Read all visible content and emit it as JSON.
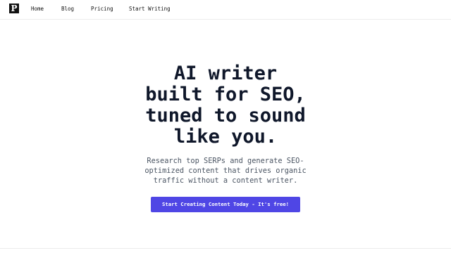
{
  "brand": {
    "logo_text": "P"
  },
  "nav": {
    "items": [
      {
        "label": "Home"
      },
      {
        "label": "Blog"
      },
      {
        "label": "Pricing"
      },
      {
        "label": "Start Writing"
      }
    ]
  },
  "hero": {
    "headline_lines": [
      "AI writer",
      "built for SEO,",
      "tuned to sound",
      "like you."
    ],
    "subtext_lines": [
      "Research top SERPs and generate SEO-",
      "optimized content that drives organic",
      "traffic without a content writer."
    ],
    "cta_label": "Start Creating Content Today - It's free!"
  },
  "colors": {
    "accent": "#4f46e5",
    "text": "#0f172a",
    "muted_text": "#4b5563",
    "logo_background": "#111111",
    "divider": "#ececec"
  }
}
